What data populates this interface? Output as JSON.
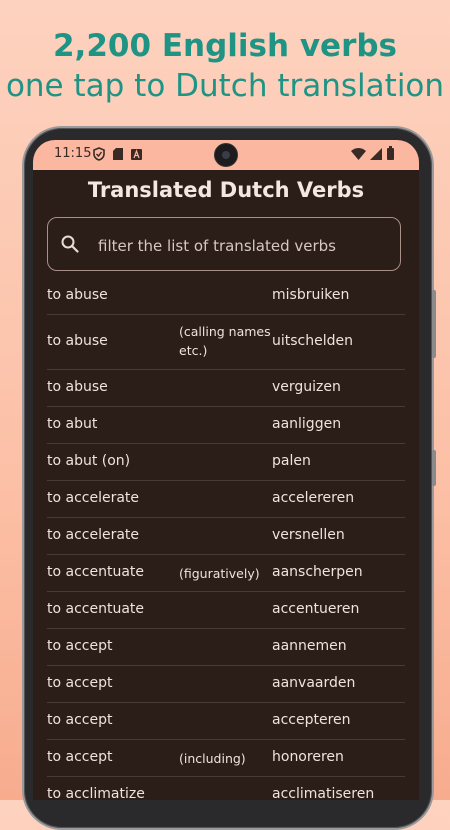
{
  "promo": {
    "line1": "2,200 English verbs",
    "line2": "one tap to Dutch translation"
  },
  "status_bar": {
    "time": "11:15",
    "icons_left": [
      "shield-icon",
      "sd-card-icon",
      "font-icon"
    ],
    "icons_right": [
      "wifi-icon",
      "signal-icon",
      "battery-icon"
    ]
  },
  "app": {
    "title": "Translated Dutch Verbs",
    "search": {
      "placeholder": "filter the list of translated verbs",
      "value": ""
    }
  },
  "verbs": [
    {
      "english": "to abuse",
      "note": "",
      "dutch": "misbruiken"
    },
    {
      "english": "to abuse",
      "note": "(calling names etc.)",
      "dutch": "uitschelden"
    },
    {
      "english": "to abuse",
      "note": "",
      "dutch": "verguizen"
    },
    {
      "english": "to abut",
      "note": "",
      "dutch": "aanliggen"
    },
    {
      "english": "to abut (on)",
      "note": "",
      "dutch": "palen"
    },
    {
      "english": "to accelerate",
      "note": "",
      "dutch": "accelereren"
    },
    {
      "english": "to accelerate",
      "note": "",
      "dutch": "versnellen"
    },
    {
      "english": "to accentuate",
      "note": "(figuratively)",
      "dutch": "aanscherpen"
    },
    {
      "english": "to accentuate",
      "note": "",
      "dutch": "accentueren"
    },
    {
      "english": "to accept",
      "note": "",
      "dutch": "aannemen"
    },
    {
      "english": "to accept",
      "note": "",
      "dutch": "aanvaarden"
    },
    {
      "english": "to accept",
      "note": "",
      "dutch": "accepteren"
    },
    {
      "english": "to accept",
      "note": "(including)",
      "dutch": "honoreren"
    },
    {
      "english": "to acclimatize",
      "note": "",
      "dutch": "acclimatiseren"
    }
  ]
}
